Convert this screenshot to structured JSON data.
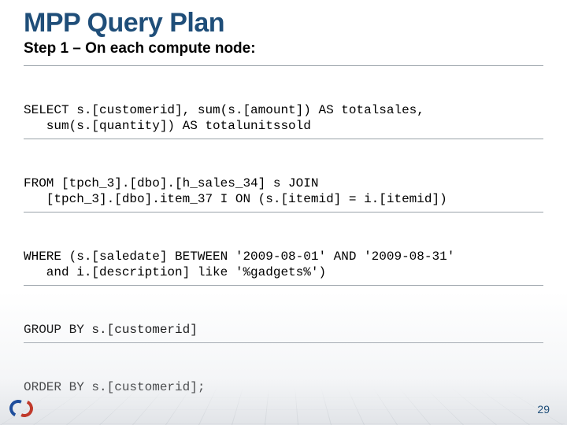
{
  "title": "MPP Query Plan",
  "subtitle": "Step 1 – On each compute node:",
  "sql": {
    "select": "SELECT s.[customerid], sum(s.[amount]) AS totalsales,\n   sum(s.[quantity]) AS totalunitssold",
    "from": "FROM [tpch_3].[dbo].[h_sales_34] s JOIN\n   [tpch_3].[dbo].item_37 I ON (s.[itemid] = i.[itemid])",
    "where": "WHERE (s.[saledate] BETWEEN '2009-08-01' AND '2009-08-31'\n   and i.[description] like '%gadgets%')",
    "group_by": "GROUP BY s.[customerid]",
    "order_by": "ORDER BY s.[customerid];"
  },
  "page_number": "29",
  "colors": {
    "heading": "#1f4e79",
    "divider": "#9aa2a9"
  }
}
